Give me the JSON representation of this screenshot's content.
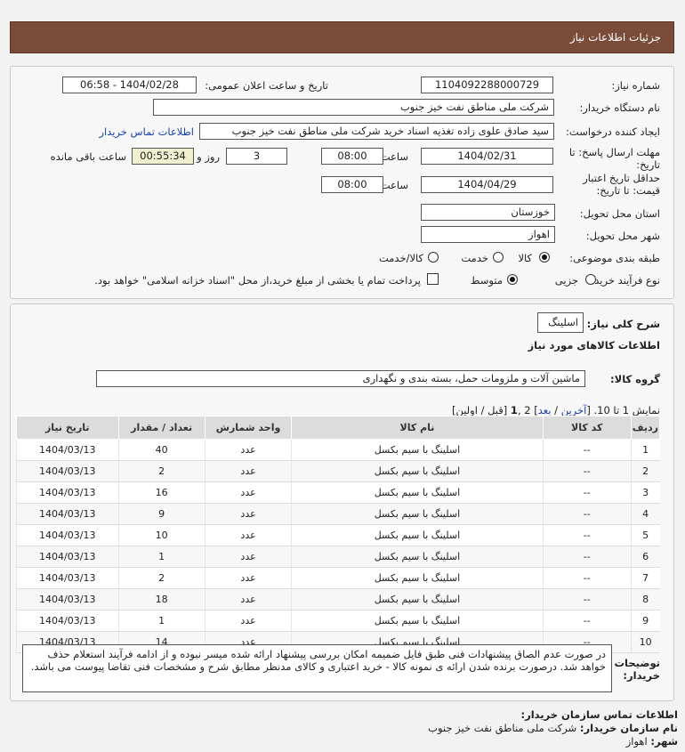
{
  "header": {
    "title": "جزئیات اطلاعات نیاز"
  },
  "form": {
    "need_number_label": "شماره نیاز:",
    "need_number": "1104092288000729",
    "announce_label": "تاریخ و ساعت اعلان عمومی:",
    "announce_value": "1404/02/28 - 06:58",
    "buyer_label": "نام دستگاه خریدار:",
    "buyer_value": "شرکت ملی مناطق نفت خیز جنوب",
    "creator_label": "ایجاد کننده درخواست:",
    "creator_value": "سید صادق علوی زاده  تغذیه اسناد خرید  شرکت ملی مناطق نفت خیز جنوب",
    "contact_link": "اطلاعات تماس خریدار",
    "deadline_label": "مهلت ارسال پاسخ: تا تاریخ:",
    "deadline_date": "1404/02/31",
    "time_label": "ساعت",
    "deadline_time": "08:00",
    "days_value": "3",
    "days_label": "روز و",
    "remaining_time": "00:55:34",
    "remaining_label": "ساعت باقی مانده",
    "validity_label": "حداقل تاریخ اعتبار قیمت: تا تاریخ:",
    "validity_date": "1404/04/29",
    "validity_time": "08:00",
    "province_label": "استان محل تحویل:",
    "province_value": "خوزستان",
    "city_label": "شهر محل تحویل:",
    "city_value": "اهواز",
    "category_label": "طبقه بندی موضوعی:",
    "category_options": [
      "کالا",
      "خدمت",
      "کالا/خدمت"
    ],
    "category_selected": "کالا",
    "process_label": "نوع فرآیند خرید :",
    "process_options": [
      "جزیی",
      "متوسط"
    ],
    "process_selected": "متوسط",
    "payment_text": "پرداخت تمام یا بخشی از مبلغ خرید،از محل \"اسناد خزانه اسلامی\" خواهد بود."
  },
  "details": {
    "summary_label": "شرح کلی نیاز:",
    "summary_value": "اسلینگ",
    "goods_heading": "اطلاعات کالاهای مورد نیاز",
    "group_label": "گروه کالا:",
    "group_value": "ماشین آلات و ملزومات حمل، بسته بندی و نگهداری",
    "paging": {
      "prefix": "نمایش 1 تا 10. [",
      "last": "آخرین",
      "sep1": " / ",
      "next": "بعد",
      "middle": "] 2 ,",
      "current": "1",
      "suffix": " [قبل / اولین]"
    },
    "columns": [
      "ردیف",
      "کد کالا",
      "نام کالا",
      "واحد شمارش",
      "تعداد / مقدار",
      "تاریخ نیاز"
    ],
    "rows": [
      [
        "1",
        "--",
        "اسلینگ با سیم بکسل",
        "عدد",
        "40",
        "1404/03/13"
      ],
      [
        "2",
        "--",
        "اسلینگ با سیم بکسل",
        "عدد",
        "2",
        "1404/03/13"
      ],
      [
        "3",
        "--",
        "اسلینگ با سیم بکسل",
        "عدد",
        "16",
        "1404/03/13"
      ],
      [
        "4",
        "--",
        "اسلینگ با سیم بکسل",
        "عدد",
        "9",
        "1404/03/13"
      ],
      [
        "5",
        "--",
        "اسلینگ با سیم بکسل",
        "عدد",
        "10",
        "1404/03/13"
      ],
      [
        "6",
        "--",
        "اسلینگ با سیم بکسل",
        "عدد",
        "1",
        "1404/03/13"
      ],
      [
        "7",
        "--",
        "اسلینگ با سیم بکسل",
        "عدد",
        "2",
        "1404/03/13"
      ],
      [
        "8",
        "--",
        "اسلینگ با سیم بکسل",
        "عدد",
        "18",
        "1404/03/13"
      ],
      [
        "9",
        "--",
        "اسلینگ با سیم بکسل",
        "عدد",
        "1",
        "1404/03/13"
      ],
      [
        "10",
        "--",
        "اسلینگ با سیم بکسل",
        "عدد",
        "14",
        "1404/03/13"
      ]
    ],
    "notes_label": "توضیحات خریدار:",
    "notes_value": "در صورت عدم الصاق پیشنهادات فنی طبق فایل ضمیمه امکان بررسی پیشنهاد ارائه شده میسر نبوده و از ادامه فرآیند استعلام حذف خواهد شد. درصورت برنده شدن ارائه ی نمونه کالا - خرید اعتباری و کالای مدنظر مطابق شرح و مشخصات فنی تقاضا پیوست می باشد."
  },
  "contact": {
    "heading": "اطلاعات تماس سازمان خریدار:",
    "org_label": "نام سازمان خریدار:",
    "org_value": "شرکت ملی مناطق نفت خیز جنوب",
    "city_label": "شهر:",
    "city_value": "اهواز"
  }
}
